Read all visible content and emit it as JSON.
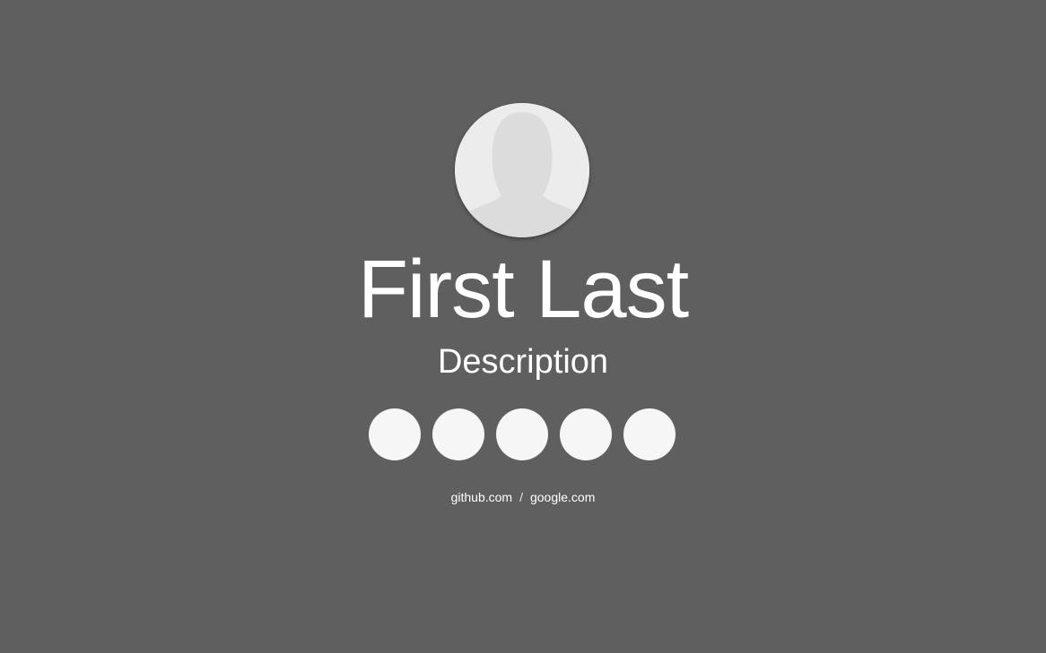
{
  "profile": {
    "name": "First Last",
    "description": "Description"
  },
  "social": {
    "buttons": [
      {
        "icon": "social-icon-1"
      },
      {
        "icon": "social-icon-2"
      },
      {
        "icon": "social-icon-3"
      },
      {
        "icon": "social-icon-4"
      },
      {
        "icon": "social-icon-5"
      }
    ]
  },
  "footer": {
    "links": [
      "github.com",
      "google.com"
    ],
    "separator": "/"
  },
  "colors": {
    "background": "#5f5f5f",
    "avatar_bg": "#ececec",
    "avatar_silhouette": "#dcdcdc",
    "button": "#f6f6f6",
    "text": "#ffffff"
  }
}
